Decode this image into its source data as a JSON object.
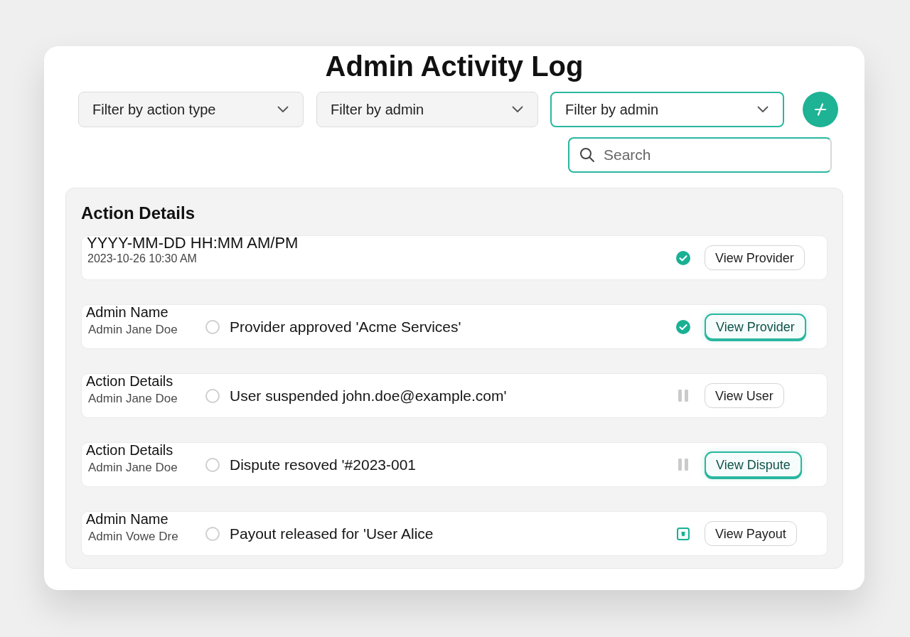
{
  "title": "Admin Activity Log",
  "filters": [
    {
      "label": "Filter by action type",
      "active": false
    },
    {
      "label": "Filter by admin",
      "active": false
    },
    {
      "label": "Filter by admin",
      "active": true
    }
  ],
  "search": {
    "placeholder": "Search"
  },
  "log": {
    "heading": "Action Details",
    "rows": [
      {
        "kind": "timestamp",
        "format": "YYYY-MM-DD HH:MM AM/PM",
        "time": "2023-10-26 10:30 AM",
        "indicator": {
          "kind": "done"
        },
        "button": {
          "label": "View Provider",
          "highlighted": false
        }
      },
      {
        "kind": "action",
        "label": "Admin Name",
        "admin": "Admin Jane Doe",
        "selected": false,
        "description": "Provider approved 'Acme Services'",
        "indicator": {
          "kind": "done"
        },
        "button": {
          "label": "View Provider",
          "highlighted": true
        }
      },
      {
        "kind": "action",
        "label": "Action Details",
        "admin": "Admin Jane Doe",
        "selected": false,
        "description": "User suspended john.doe@example.com'",
        "indicator": {
          "kind": "paused"
        },
        "button": {
          "label": "View User",
          "highlighted": false
        }
      },
      {
        "kind": "action",
        "label": "Action Details",
        "admin": "Admin Jane Doe",
        "selected": false,
        "description": "Dispute resoved '#2023-001",
        "indicator": {
          "kind": "paused"
        },
        "button": {
          "label": "View Dispute",
          "highlighted": true
        }
      },
      {
        "kind": "action",
        "label": "Admin Name",
        "admin": "Admin Vowe Dre",
        "selected": false,
        "description": "Payout released for 'User Alice",
        "indicator": {
          "kind": "paid"
        },
        "button": {
          "label": "View Payout",
          "highlighted": false
        }
      }
    ]
  }
}
